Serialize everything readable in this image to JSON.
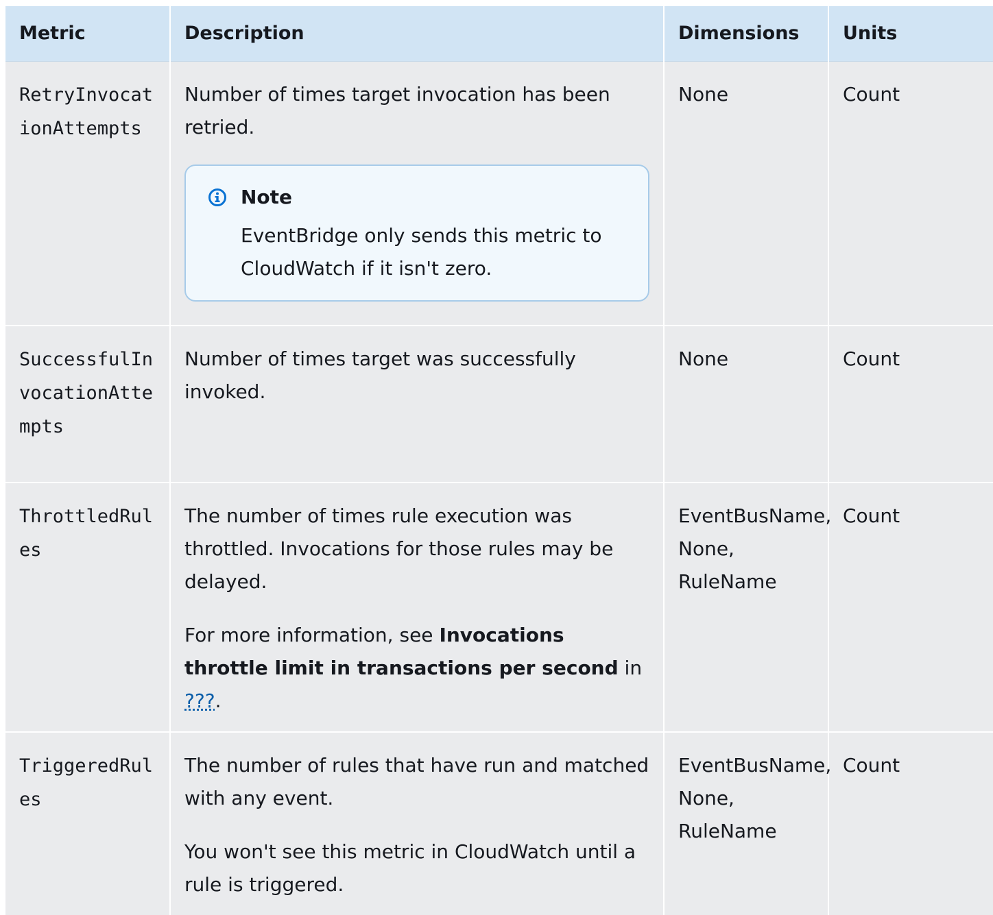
{
  "table": {
    "headers": {
      "metric": "Metric",
      "description": "Description",
      "dimensions": "Dimensions",
      "units": "Units"
    },
    "rows": [
      {
        "metric": "RetryInvocationAttempts",
        "description": "Number of times target invocation has been retried.",
        "note": {
          "title": "Note",
          "text": "EventBridge only sends this metric to CloudWatch if it isn't zero."
        },
        "dimensions": "None",
        "units": "Count"
      },
      {
        "metric": "SuccessfulInvocationAttempts",
        "description": "Number of times target was successfully invoked.",
        "dimensions": "None",
        "units": "Count"
      },
      {
        "metric": "ThrottledRules",
        "description": "The number of times rule execution was throttled. Invocations for those rules may be delayed.",
        "more_info": {
          "prefix": "For more information, see ",
          "bold": "Invocations throttle limit in transactions per second",
          "middle": " in ",
          "link": "???",
          "suffix": "."
        },
        "dimensions": "EventBusName, None, RuleName",
        "units": "Count"
      },
      {
        "metric": "TriggeredRules",
        "description": "The number of rules that have run and matched with any event.",
        "extra": "You won't see this metric in CloudWatch until a rule is triggered.",
        "dimensions": "EventBusName, None, RuleName",
        "units": "Count"
      }
    ]
  },
  "icons": {
    "note": "info-circle-icon",
    "note_color": "#0972d3"
  }
}
